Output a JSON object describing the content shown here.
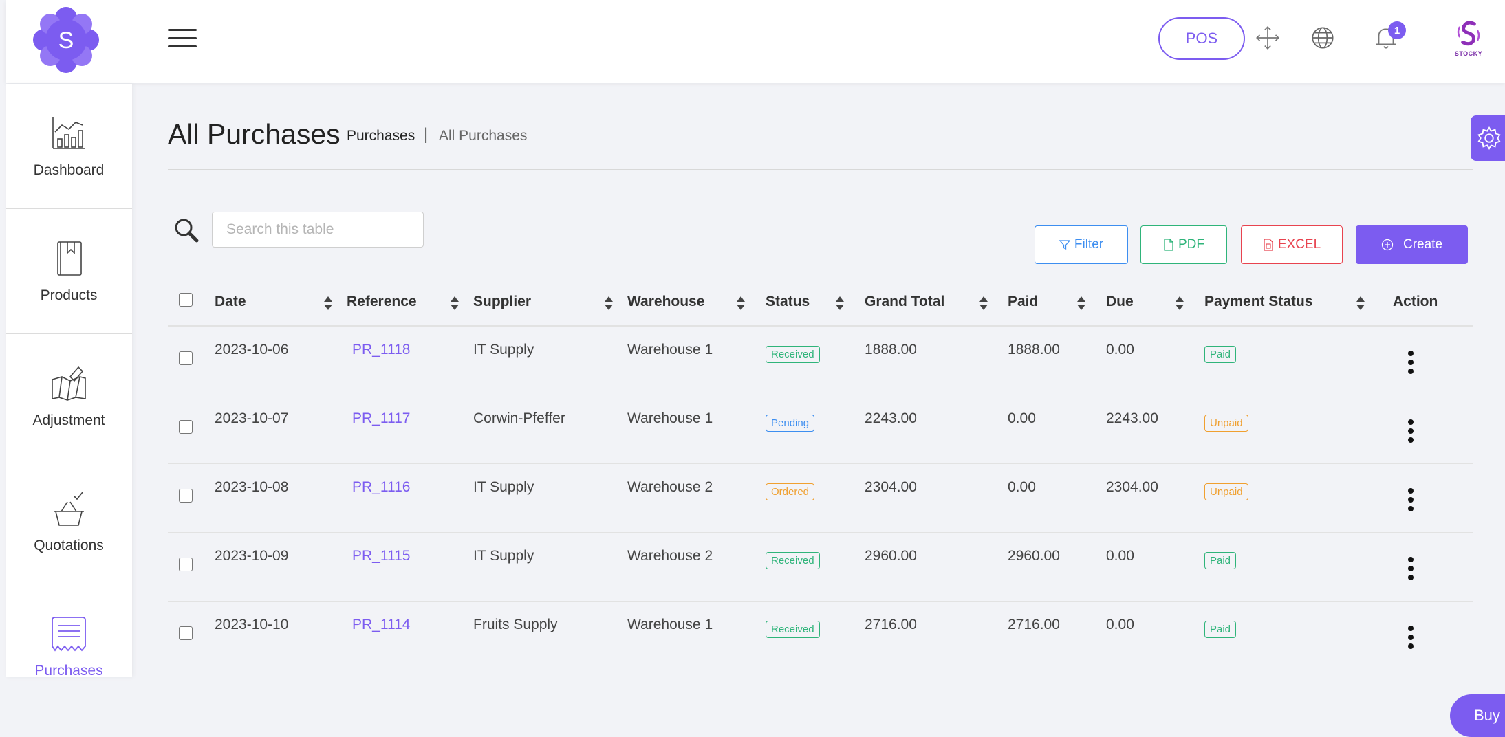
{
  "topbar": {
    "logo_letter": "S",
    "pos_label": "POS",
    "notification_count": "1",
    "brand_text": "STOCKY"
  },
  "sidebar": {
    "items": [
      {
        "label": "Dashboard",
        "icon": "chart-icon"
      },
      {
        "label": "Products",
        "icon": "book-icon"
      },
      {
        "label": "Adjustment",
        "icon": "map-pencil-icon"
      },
      {
        "label": "Quotations",
        "icon": "basket-check-icon"
      },
      {
        "label": "Purchases",
        "icon": "receipt-icon"
      }
    ],
    "active": "Purchases"
  },
  "page": {
    "title": "All Purchases",
    "breadcrumb_parent": "Purchases",
    "breadcrumb_separator": "|",
    "breadcrumb_current": "All Purchases"
  },
  "toolbar": {
    "search_placeholder": "Search this table",
    "filter_label": "Filter",
    "pdf_label": "PDF",
    "excel_label": "EXCEL",
    "create_label": "Create"
  },
  "table": {
    "columns": [
      "Date",
      "Reference",
      "Supplier",
      "Warehouse",
      "Status",
      "Grand Total",
      "Paid",
      "Due",
      "Payment Status",
      "Action"
    ],
    "rows": [
      {
        "date": "2023-10-06",
        "reference": "PR_1118",
        "supplier": "IT Supply",
        "warehouse": "Warehouse 1",
        "status": "Received",
        "grand_total": "1888.00",
        "paid": "1888.00",
        "due": "0.00",
        "payment_status": "Paid"
      },
      {
        "date": "2023-10-07",
        "reference": "PR_1117",
        "supplier": "Corwin-Pfeffer",
        "warehouse": "Warehouse 1",
        "status": "Pending",
        "grand_total": "2243.00",
        "paid": "0.00",
        "due": "2243.00",
        "payment_status": "Unpaid"
      },
      {
        "date": "2023-10-08",
        "reference": "PR_1116",
        "supplier": "IT Supply",
        "warehouse": "Warehouse 2",
        "status": "Ordered",
        "grand_total": "2304.00",
        "paid": "0.00",
        "due": "2304.00",
        "payment_status": "Unpaid"
      },
      {
        "date": "2023-10-09",
        "reference": "PR_1115",
        "supplier": "IT Supply",
        "warehouse": "Warehouse 2",
        "status": "Received",
        "grand_total": "2960.00",
        "paid": "2960.00",
        "due": "0.00",
        "payment_status": "Paid"
      },
      {
        "date": "2023-10-10",
        "reference": "PR_1114",
        "supplier": "Fruits Supply",
        "warehouse": "Warehouse 1",
        "status": "Received",
        "grand_total": "2716.00",
        "paid": "2716.00",
        "due": "0.00",
        "payment_status": "Paid"
      }
    ]
  },
  "buy_button_label": "Buy Stocky",
  "colors": {
    "accent": "#7c5cf0",
    "received": "#2fb47a",
    "pending": "#3d8ef0",
    "ordered": "#f0a030",
    "excel": "#e8434f"
  }
}
